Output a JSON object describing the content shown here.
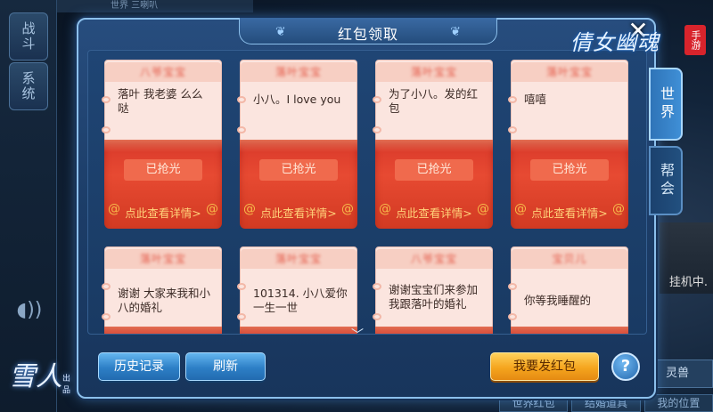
{
  "background": {
    "side_tabs": [
      "战斗",
      "系统"
    ],
    "top_strip": "世界  三喇叭",
    "right_text": "挂机中.",
    "right_button": "灵兽",
    "bottom_tabs": [
      "世界红包",
      "结婚道具",
      "我的位置"
    ],
    "game_logo": "雪人",
    "game_logo_small": "出品"
  },
  "brand": {
    "name": "倩女幽魂",
    "tag": "手游"
  },
  "panel": {
    "title": "红包领取",
    "close_icon": "close-icon",
    "tabs": [
      {
        "label": "世界",
        "active": true
      },
      {
        "label": "帮会",
        "active": false
      }
    ]
  },
  "red_packets": [
    {
      "sender": "八爷宝宝",
      "message": "落叶 我老婆 么么哒",
      "status": "已抢光",
      "detail": "点此查看详情>"
    },
    {
      "sender": "落叶宝宝",
      "message": "小八。I love you",
      "status": "已抢光",
      "detail": "点此查看详情>"
    },
    {
      "sender": "落叶宝宝",
      "message": "为了小八。发的红包",
      "status": "已抢光",
      "detail": "点此查看详情>"
    },
    {
      "sender": "落叶宝宝",
      "message": "嘻嘻",
      "status": "已抢光",
      "detail": "点此查看详情>"
    },
    {
      "sender": "落叶宝宝",
      "message": "谢谢 大家来我和小八的婚礼",
      "status": "",
      "detail": ""
    },
    {
      "sender": "落叶宝宝",
      "message": "101314. 小八爱你一生一世",
      "status": "",
      "detail": ""
    },
    {
      "sender": "八爷宝宝",
      "message": "谢谢宝宝们来参加我跟落叶的婚礼",
      "status": "",
      "detail": ""
    },
    {
      "sender": "宝贝儿",
      "message": "你等我睡醒的",
      "status": "",
      "detail": ""
    }
  ],
  "buttons": {
    "history": "历史记录",
    "refresh": "刷新",
    "send": "我要发红包",
    "help": "?"
  },
  "colors": {
    "panel_bg": "#1c3d68",
    "panel_border": "#8cc0ec",
    "packet_red": "#e74a32",
    "packet_paper": "#fbe5df",
    "gold_button": "#f5a51e",
    "blue_button": "#2d7fc6"
  }
}
